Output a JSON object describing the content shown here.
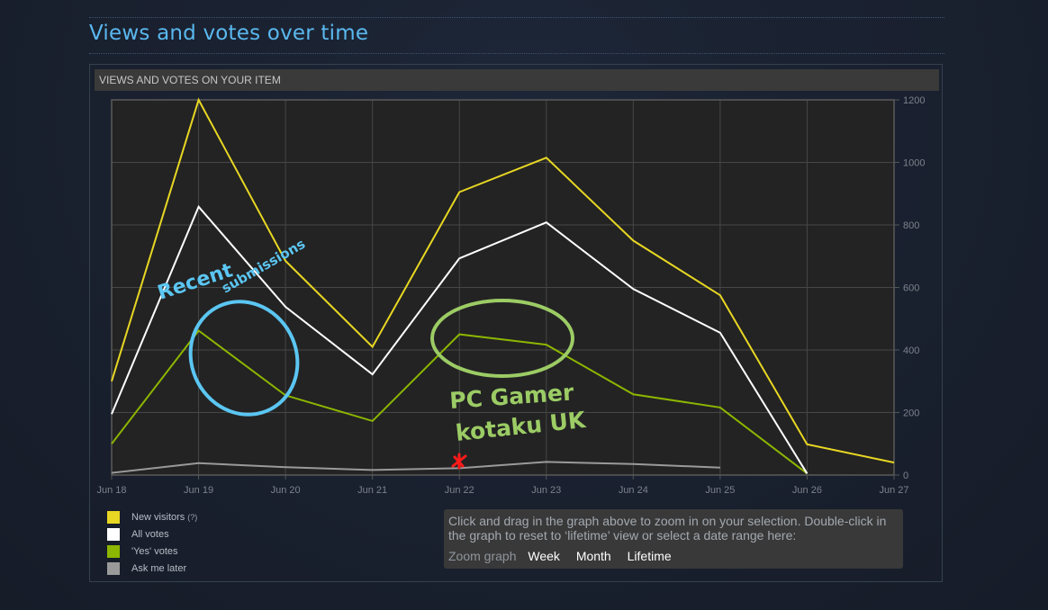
{
  "page": {
    "title": "Views and votes over time",
    "box_header": "VIEWS AND VOTES ON YOUR ITEM"
  },
  "legend": [
    {
      "label": "New visitors",
      "help": "(?)",
      "color": "#e8d723"
    },
    {
      "label": "All votes",
      "help": "",
      "color": "#ffffff"
    },
    {
      "label": "'Yes' votes",
      "help": "",
      "color": "#8db600"
    },
    {
      "label": "Ask me later",
      "help": "",
      "color": "#9a9a9a"
    }
  ],
  "zoom_panel": {
    "description": "Click and drag in the graph above to zoom in on your selection. Double-click in the graph to reset to ‘lifetime’ view or select a date range here:",
    "label": "Zoom graph",
    "options": [
      "Week",
      "Month",
      "Lifetime"
    ]
  },
  "annotations": [
    {
      "text_line1": "Recent",
      "text_line2": "submissions",
      "color": "#5bc6f2",
      "target": "Jun 19 - Jun 20"
    },
    {
      "text_line1": "PC Gamer",
      "text_line2": "kotaku UK",
      "color": "#9ccc65",
      "target": "Jun 22 - Jun 23"
    },
    {
      "marker": "red-star",
      "color": "#ff1a1a",
      "target": "Jun 22"
    }
  ],
  "chart_data": {
    "type": "line",
    "title": "VIEWS AND VOTES ON YOUR ITEM",
    "xlabel": "",
    "ylabel": "",
    "x": [
      "Jun 18",
      "Jun 19",
      "Jun 20",
      "Jun 21",
      "Jun 22",
      "Jun 23",
      "Jun 24",
      "Jun 25",
      "Jun 26",
      "Jun 27"
    ],
    "ylim": [
      0,
      1200
    ],
    "yticks": [
      0,
      200,
      400,
      600,
      800,
      1000,
      1200
    ],
    "y_axis_side": "right",
    "grid": true,
    "legend_position": "bottom-left",
    "series": [
      {
        "name": "New visitors",
        "color": "#e8d723",
        "values": [
          300,
          1200,
          685,
          410,
          905,
          1015,
          750,
          575,
          98,
          40
        ]
      },
      {
        "name": "All votes",
        "color": "#ffffff",
        "values": [
          195,
          858,
          538,
          322,
          693,
          808,
          595,
          455,
          5,
          null
        ]
      },
      {
        "name": "'Yes' votes",
        "color": "#8db600",
        "values": [
          100,
          462,
          255,
          173,
          450,
          417,
          258,
          216,
          5,
          null
        ]
      },
      {
        "name": "Ask me later",
        "color": "#9a9a9a",
        "values": [
          7,
          38,
          25,
          16,
          22,
          42,
          35,
          24,
          null,
          null
        ]
      }
    ]
  }
}
